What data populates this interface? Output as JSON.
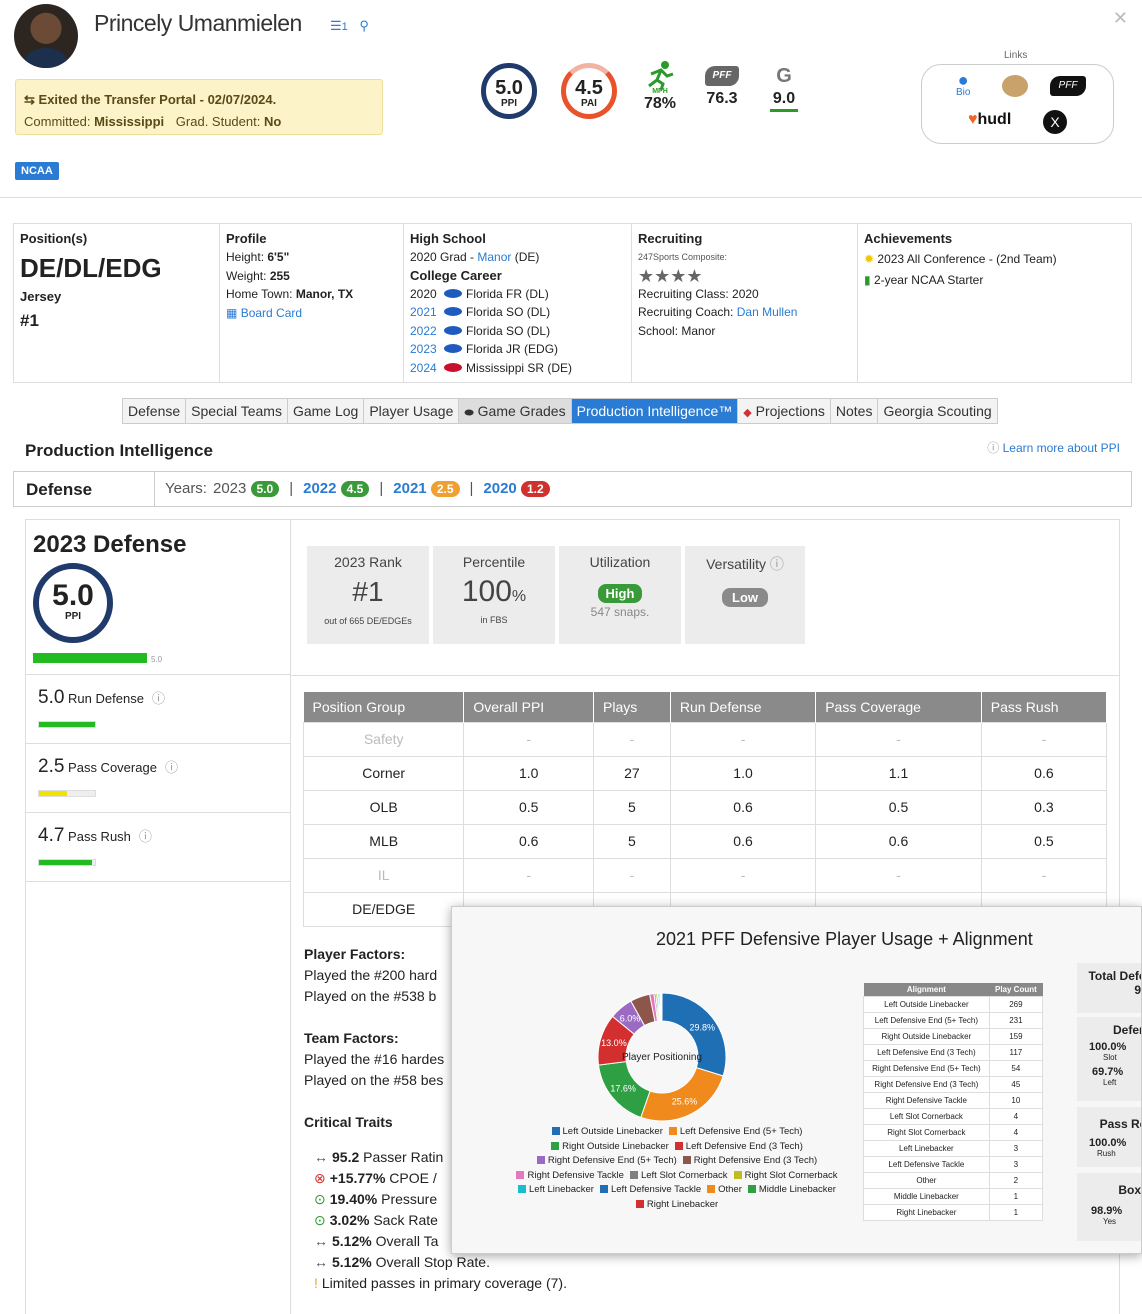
{
  "header": {
    "player_name": "Princely Umanmielen",
    "list_count": "1",
    "portal_line": "Exited the Transfer Portal - 02/07/2024.",
    "committed_label": "Committed:",
    "committed_value": "Mississippi",
    "grad_label": "Grad. Student:",
    "grad_value": "No",
    "ncaa_badge": "NCAA",
    "ppi_value": "5.0",
    "ppi_label": "PPI",
    "pai_value": "4.5",
    "pai_label": "PAI",
    "pai_progress": 0.9,
    "mph_label": "MPH",
    "mph_value": "78%",
    "pff_value": "76.3",
    "grade_value": "9.0",
    "links_title": "Links",
    "links": {
      "bio": "Bio",
      "hudl": "hudl"
    }
  },
  "info": {
    "position_title": "Position(s)",
    "position_value": "DE/DL/EDG",
    "jersey_title": "Jersey",
    "jersey_value": "#1",
    "profile_title": "Profile",
    "height_label": "Height:",
    "height_value": "6'5\"",
    "weight_label": "Weight:",
    "weight_value": "255",
    "hometown_label": "Home Town:",
    "hometown_value": "Manor, TX",
    "board_card": "Board Card",
    "hs_title": "High School",
    "hs_grad": "2020 Grad -",
    "hs_school": "Manor",
    "hs_pos": "(DE)",
    "college_title": "College Career",
    "career": [
      {
        "year": "2020",
        "linked": false,
        "team": "Florida FR (DL)"
      },
      {
        "year": "2021",
        "linked": true,
        "team": "Florida SO (DL)"
      },
      {
        "year": "2022",
        "linked": true,
        "team": "Florida SO (DL)"
      },
      {
        "year": "2023",
        "linked": true,
        "team": "Florida JR (EDG)"
      },
      {
        "year": "2024",
        "linked": true,
        "team": "Mississippi SR (DE)"
      }
    ],
    "rec_title": "Recruiting",
    "rec_composite": "247Sports Composite:",
    "rec_stars": "★★★★",
    "rec_class": "Recruiting Class: 2020",
    "rec_coach_label": "Recruiting Coach:",
    "rec_coach": "Dan Mullen",
    "rec_school": "School: Manor",
    "ach_title": "Achievements",
    "achievements": [
      "2023 All Conference - (2nd Team)",
      "2-year NCAA Starter"
    ]
  },
  "tabs": [
    "Defense",
    "Special Teams",
    "Game Log",
    "Player Usage",
    "Game Grades",
    "Production Intelligence™",
    "Projections",
    "Notes",
    "Georgia Scouting"
  ],
  "section": {
    "title": "Production Intelligence",
    "learn_more": "Learn more about PPI",
    "defense_label": "Defense",
    "years_label": "Years:",
    "years": [
      {
        "year": "2023",
        "score": "5.0",
        "color": "#3a9a3a",
        "linked": false
      },
      {
        "year": "2022",
        "score": "4.5",
        "color": "#3a9a3a",
        "linked": true
      },
      {
        "year": "2021",
        "score": "2.5",
        "color": "#f0a030",
        "linked": true
      },
      {
        "year": "2020",
        "score": "1.2",
        "color": "#d0312d",
        "linked": true
      }
    ]
  },
  "summary": {
    "title": "2023 Defense",
    "ppi_value": "5.0",
    "ppi_label": "PPI",
    "bar_value": "5.0",
    "bar_fraction": 1.0,
    "rank_title": "2023 Rank",
    "rank_value": "#1",
    "rank_sub": "out of 665 DE/EDGEs",
    "pct_title": "Percentile",
    "pct_value": "100",
    "pct_unit": "%",
    "pct_sub": "in FBS",
    "util_title": "Utilization",
    "util_badge": "High",
    "util_sub": "547 snaps.",
    "vers_title": "Versatility",
    "vers_badge": "Low"
  },
  "subscores": [
    {
      "value": "5.0",
      "label": "Run Defense",
      "fraction": 1.0,
      "color": "#22bb22"
    },
    {
      "value": "2.5",
      "label": "Pass Coverage",
      "fraction": 0.5,
      "color": "#f2e200"
    },
    {
      "value": "4.7",
      "label": "Pass Rush",
      "fraction": 0.94,
      "color": "#22bb22"
    }
  ],
  "position_table": {
    "headers": [
      "Position Group",
      "Overall PPI",
      "Plays",
      "Run Defense",
      "Pass Coverage",
      "Pass Rush"
    ],
    "rows": [
      [
        "Safety",
        "-",
        "-",
        "-",
        "-",
        "-"
      ],
      [
        "Corner",
        "1.0",
        "27",
        "1.0",
        "1.1",
        "0.6"
      ],
      [
        "OLB",
        "0.5",
        "5",
        "0.6",
        "0.5",
        "0.3"
      ],
      [
        "MLB",
        "0.6",
        "5",
        "0.6",
        "0.6",
        "0.5"
      ],
      [
        "IL",
        "-",
        "-",
        "-",
        "-",
        "-"
      ],
      [
        "DE/EDGE",
        "",
        "",
        "",
        "",
        ""
      ]
    ]
  },
  "factors": {
    "player_title": "Player Factors:",
    "player_lines": [
      "Played the #200 hard",
      "Played on the #538 b"
    ],
    "team_title": "Team Factors:",
    "team_lines": [
      "Played the #16 hardes",
      "Played on the #58 bes"
    ],
    "traits_title": "Critical Traits",
    "traits": [
      {
        "icon": "↔",
        "color": "#555",
        "bold": "95.2",
        "text": " Passer Ratin"
      },
      {
        "icon": "⊗",
        "color": "#d0312d",
        "bold": "+15.77%",
        "text": " CPOE /"
      },
      {
        "icon": "⊙",
        "color": "#2a9a2a",
        "bold": "19.40%",
        "text": " Pressure"
      },
      {
        "icon": "⊙",
        "color": "#2a9a2a",
        "bold": "3.02%",
        "text": " Sack Rate"
      },
      {
        "icon": "↔",
        "color": "#555",
        "bold": "5.12%",
        "text": " Overall Ta"
      },
      {
        "icon": "↔",
        "color": "#555",
        "bold": "5.12%",
        "text": " Overall Stop Rate."
      },
      {
        "icon": "!",
        "color": "#f0a030",
        "bold": "",
        "text": "Limited passes in primary coverage (7)."
      }
    ]
  },
  "popup": {
    "title": "2021 PFF Defensive Player Usage + Alignment",
    "center_label": "Player Positioning",
    "chart_data": {
      "type": "pie",
      "title": "2021 PFF Defensive Player Usage + Alignment",
      "categories": [
        "Left Outside Linebacker",
        "Left Defensive End (5+ Tech)",
        "Right Outside Linebacker",
        "Right Defensive End (3 Tech)",
        "Right Defensive End (5+ Tech)",
        "Left Defensive End (3 Tech)",
        "Right Defensive Tackle",
        "Left Slot Cornerback",
        "Right Slot Cornerback",
        "Left Linebacker",
        "Left Defensive Tackle",
        "Other",
        "Middle Linebacker",
        "Right Linebacker"
      ],
      "values": [
        269,
        231,
        159,
        117,
        54,
        45,
        10,
        4,
        4,
        3,
        3,
        2,
        1,
        1
      ],
      "slice_labels": [
        "29.8%",
        "25.6%",
        "17.6%",
        "13.0%",
        "6.0%",
        "",
        "",
        "",
        "",
        "",
        "",
        "",
        "",
        ""
      ],
      "colors": [
        "#1f6fb5",
        "#f08a1c",
        "#2ea043",
        "#d32f2f",
        "#9b6bc4",
        "#8c564b",
        "#e377c2",
        "#7f7f7f",
        "#bcbd22",
        "#17becf",
        "#1f6fb5",
        "#f08a1c",
        "#2ea043",
        "#d32f2f"
      ]
    },
    "legend_rows": [
      [
        "Left Outside Linebacker",
        "Left Defensive End (5+ Tech)"
      ],
      [
        "Right Outside Linebacker",
        "Left Defensive End (3 Tech)"
      ],
      [
        "Right Defensive End (5+ Tech)",
        "Right Defensive End (3 Tech)"
      ],
      [
        "Right Defensive Tackle",
        "Left Slot Cornerback",
        "Right Slot Cornerback"
      ],
      [
        "Left Linebacker",
        "Left Defensive Tackle",
        "Other",
        "Middle Linebacker"
      ],
      [
        "Right Linebacker"
      ]
    ],
    "legend_colors": [
      [
        "#1f6fb5",
        "#f08a1c"
      ],
      [
        "#2ea043",
        "#d32f2f"
      ],
      [
        "#9b6bc4",
        "#8c564b"
      ],
      [
        "#e377c2",
        "#7f7f7f",
        "#bcbd22"
      ],
      [
        "#17becf",
        "#1f6fb5",
        "#f08a1c",
        "#2ea043"
      ],
      [
        "#d32f2f"
      ]
    ],
    "align_headers": [
      "Alignment",
      "Play Count"
    ],
    "align_rows": [
      [
        "Left Outside Linebacker",
        "269"
      ],
      [
        "Left Defensive End (5+ Tech)",
        "231"
      ],
      [
        "Right Outside Linebacker",
        "159"
      ],
      [
        "Left Defensive End (3 Tech)",
        "117"
      ],
      [
        "Right Defensive End (5+ Tech)",
        "54"
      ],
      [
        "Right Defensive End (3 Tech)",
        "45"
      ],
      [
        "Right Defensive Tackle",
        "10"
      ],
      [
        "Left Slot Cornerback",
        "4"
      ],
      [
        "Right Slot Cornerback",
        "4"
      ],
      [
        "Left Linebacker",
        "3"
      ],
      [
        "Left Defensive Tackle",
        "3"
      ],
      [
        "Other",
        "2"
      ],
      [
        "Middle Linebacker",
        "1"
      ],
      [
        "Right Linebacker",
        "1"
      ]
    ],
    "right_panel": {
      "total_title": "Total Defe",
      "total_value": "9",
      "defs_title": "Defens",
      "slot_pct": "100.0%",
      "slot_label": "Slot",
      "left_pct": "69.7%",
      "left_label": "Left",
      "passres_title": "Pass Res",
      "rush_pct": "100.0%",
      "rush_label": "Rush",
      "box_title": "Box",
      "yes_pct": "98.9%",
      "yes_label": "Yes"
    }
  }
}
